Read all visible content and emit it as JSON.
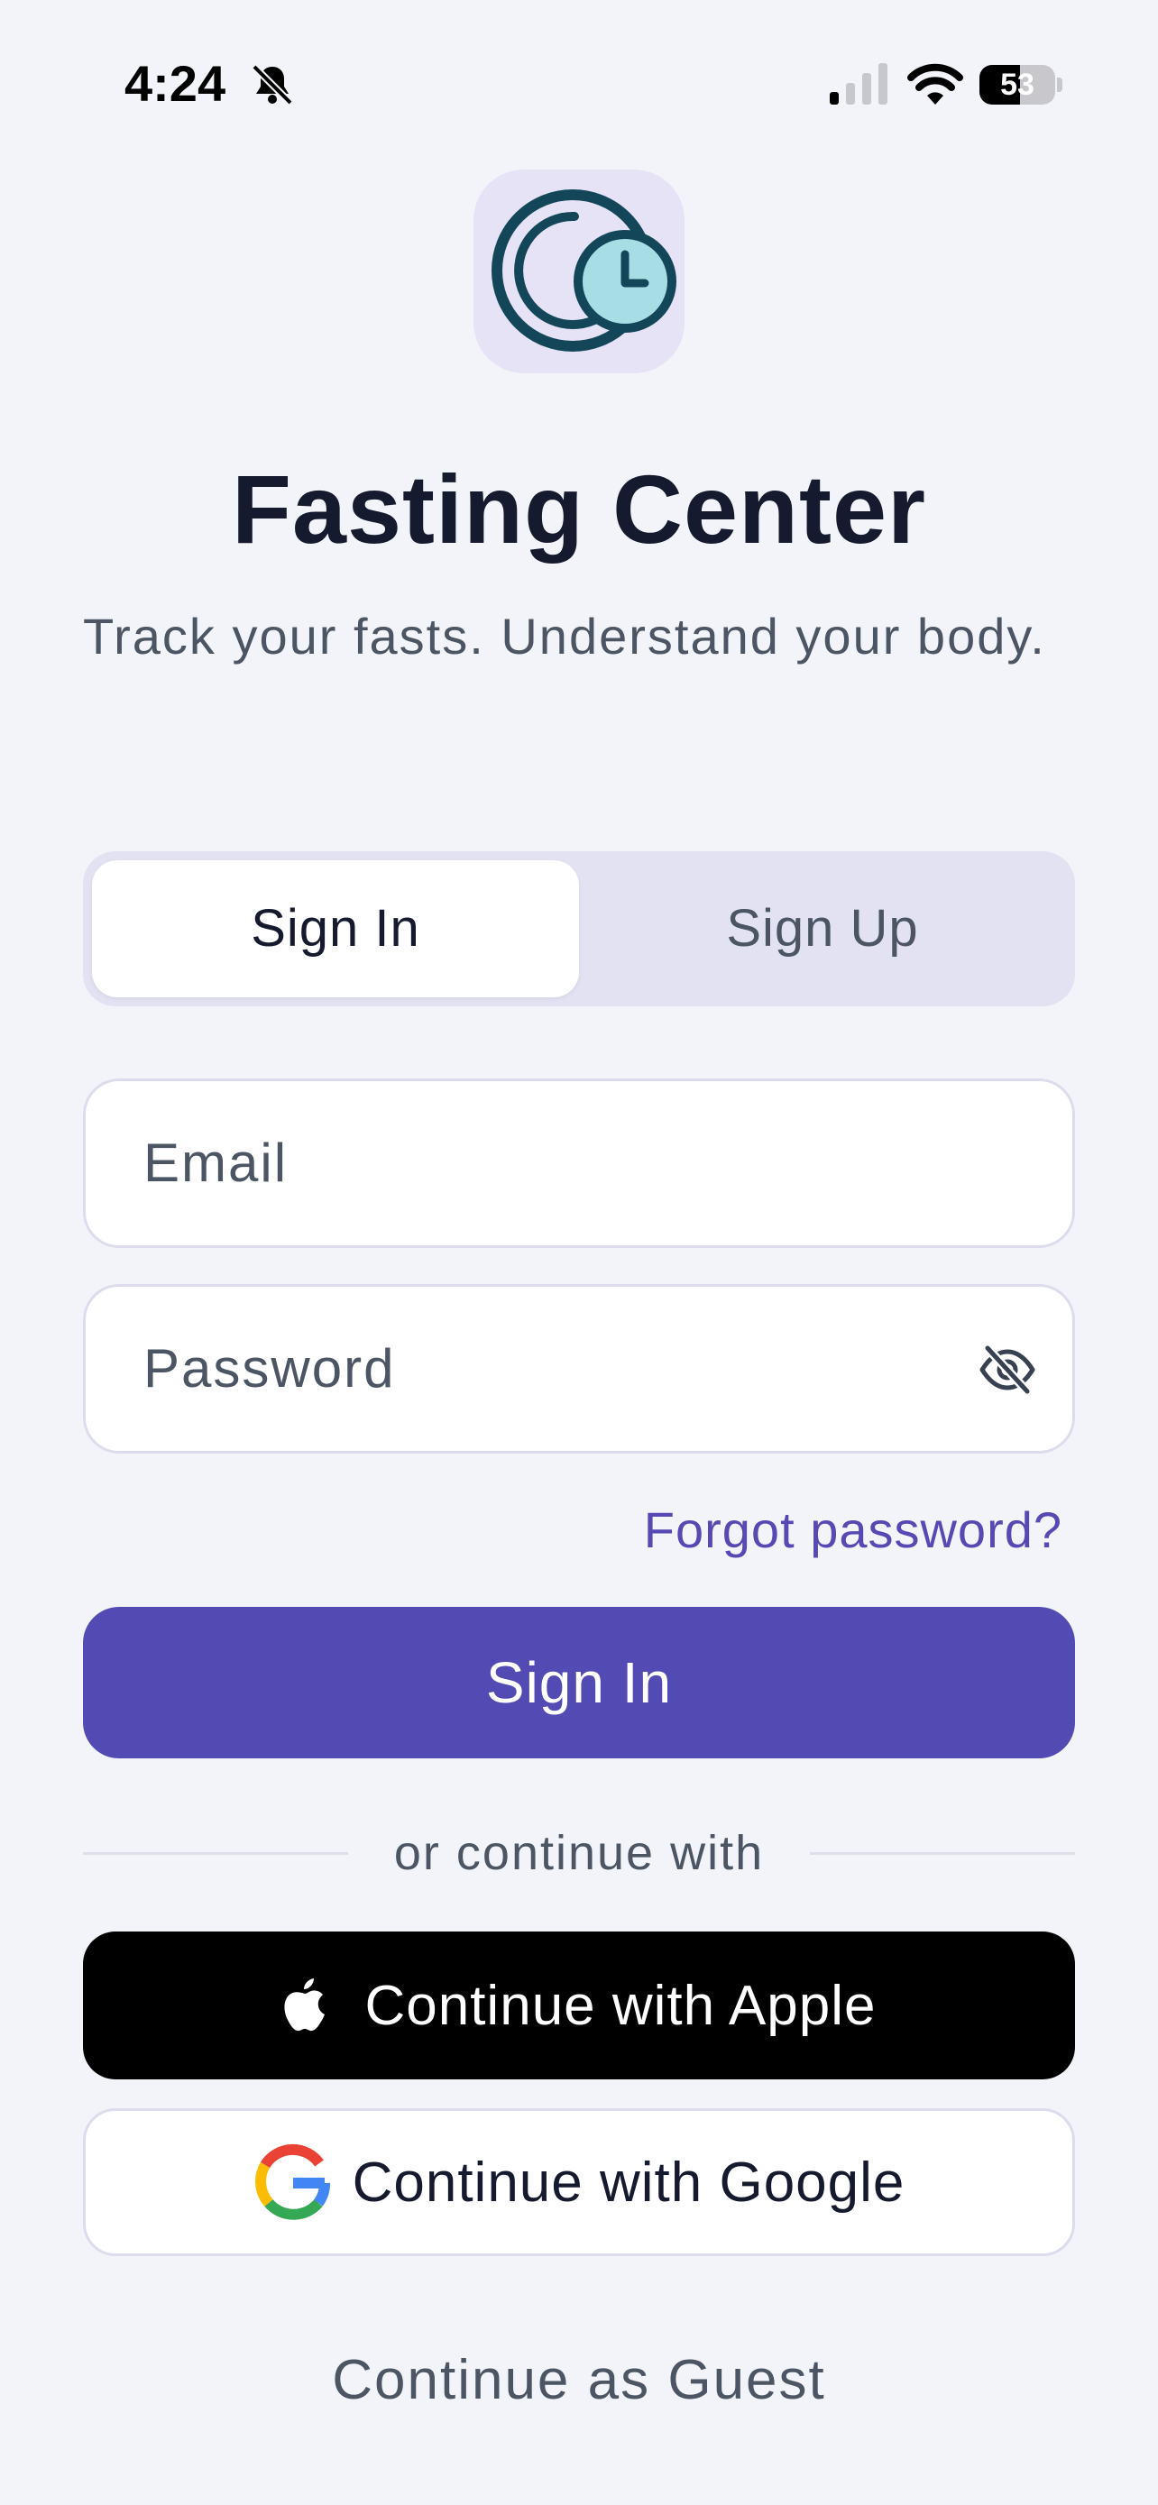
{
  "status_bar": {
    "time": "4:24",
    "battery_percent": "53",
    "battery_level": 0.53,
    "icons": [
      "bell-slash-icon",
      "cellular-signal-icon",
      "wifi-icon",
      "battery-icon"
    ]
  },
  "app": {
    "logo_icon": "moon-clock-icon",
    "title": "Fasting Center",
    "tagline": "Track your fasts. Understand your body."
  },
  "auth_tabs": {
    "items": [
      {
        "label": "Sign In",
        "selected": true
      },
      {
        "label": "Sign Up",
        "selected": false
      }
    ]
  },
  "form": {
    "email_placeholder": "Email",
    "password_placeholder": "Password",
    "password_visibility_icon": "eye-slash-icon",
    "forgot_label": "Forgot password?",
    "submit_label": "Sign In"
  },
  "social": {
    "divider_text": "or continue with",
    "apple_label": "Continue with Apple",
    "google_label": "Continue with Google"
  },
  "guest_label": "Continue as Guest",
  "colors": {
    "background": "#f3f4f9",
    "accent": "#534bb4",
    "link": "#5749b4",
    "text_primary": "#161a2e",
    "text_secondary": "#4b5563",
    "segment_bg": "#e3e2f3",
    "logo_bg": "#e6e3f6"
  }
}
